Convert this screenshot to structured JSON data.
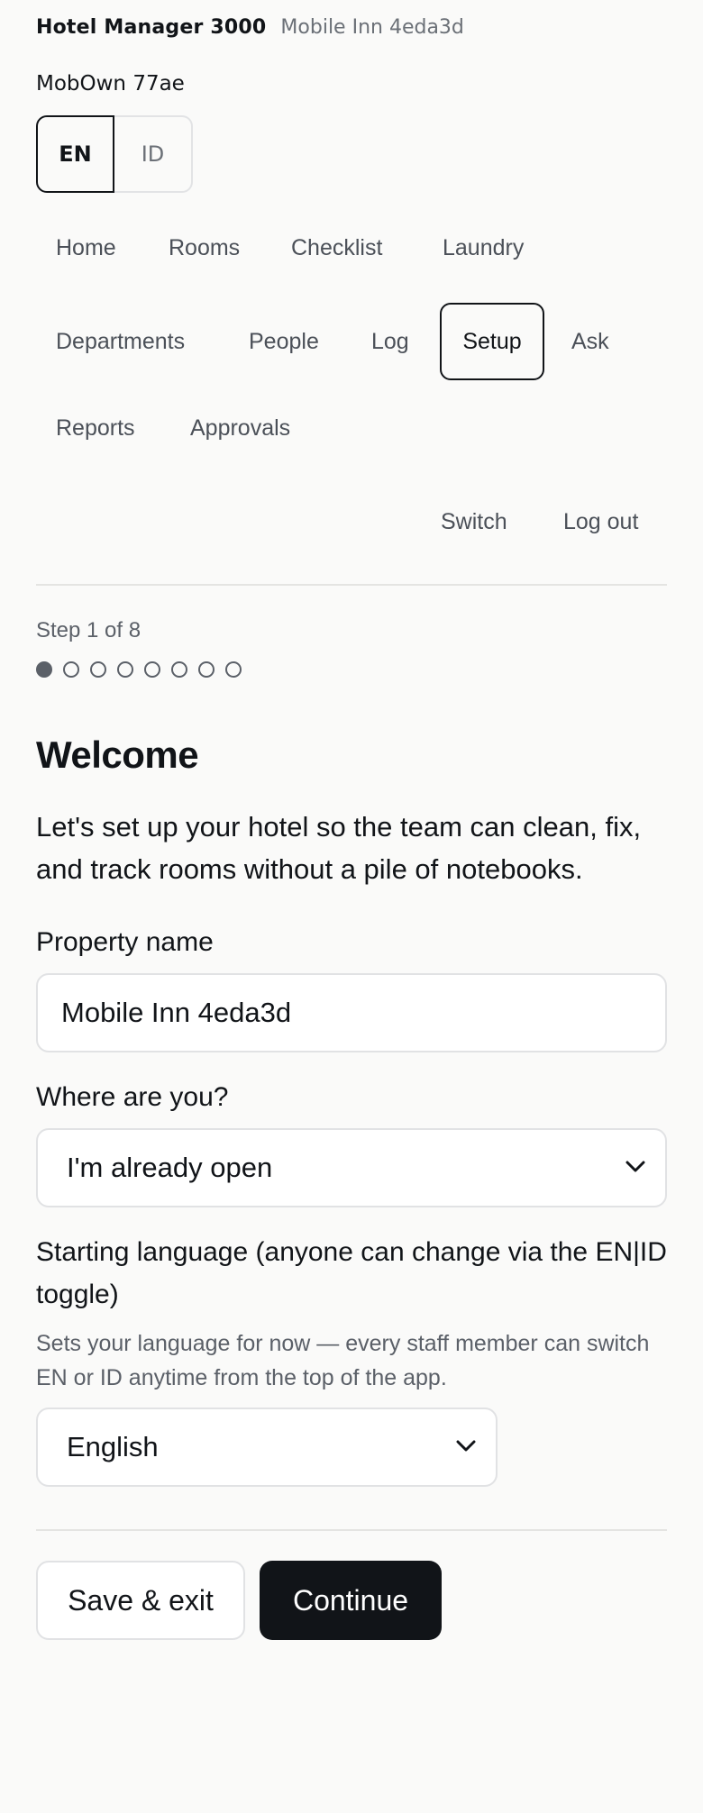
{
  "header": {
    "app_title": "Hotel Manager 3000",
    "property": "Mobile Inn 4eda3d",
    "owner": "MobOwn 77ae"
  },
  "language_toggle": {
    "options": [
      "EN",
      "ID"
    ],
    "active": "EN"
  },
  "nav": {
    "items": [
      {
        "label": "Home"
      },
      {
        "label": "Rooms"
      },
      {
        "label": "Checklist"
      },
      {
        "label": "Laundry"
      },
      {
        "label": "Departments"
      },
      {
        "label": "People"
      },
      {
        "label": "Log"
      },
      {
        "label": "Setup"
      },
      {
        "label": "Ask"
      },
      {
        "label": "Reports"
      },
      {
        "label": "Approvals"
      }
    ],
    "active": "Setup",
    "switch_label": "Switch",
    "logout_label": "Log out"
  },
  "wizard": {
    "step_text": "Step 1 of 8",
    "current_step": 1,
    "total_steps": 8,
    "title": "Welcome",
    "intro": "Let's set up your hotel so the team can clean, fix, and track rooms without a pile of notebooks.",
    "property_name": {
      "label": "Property name",
      "value": "Mobile Inn 4eda3d"
    },
    "status": {
      "label": "Where are you?",
      "selected": "I'm already open"
    },
    "language": {
      "label": "Starting language (anyone can change via the EN|ID toggle)",
      "help": "Sets your language for now — every staff member can switch EN or ID anytime from the top of the app.",
      "selected": "English"
    },
    "save_exit_label": "Save & exit",
    "continue_label": "Continue"
  },
  "colors": {
    "background": "#fafaf9",
    "text": "#111418",
    "muted": "#6b7077",
    "primary_button": "#111418",
    "border": "#e1e2e4"
  },
  "icons": {
    "select_caret": "chevron-down-icon",
    "step_dot_filled": "filled-circle",
    "step_dot_empty": "hollow-circle"
  }
}
